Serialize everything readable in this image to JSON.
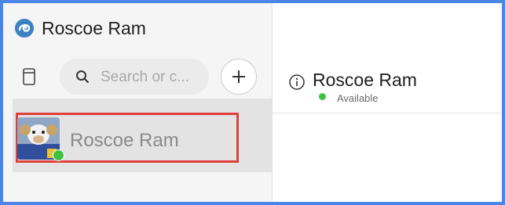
{
  "app": {
    "title": "Roscoe Ram"
  },
  "search": {
    "placeholder": "Search or c..."
  },
  "contacts": [
    {
      "name": "Roscoe Ram",
      "status": "online"
    }
  ],
  "chat": {
    "title": "Roscoe Ram",
    "status": "Available"
  },
  "colors": {
    "frame": "#4a86e8",
    "highlight": "#e0403c",
    "online": "#3fc23f"
  },
  "icons": [
    "app-logo-icon",
    "compose-icon",
    "search-icon",
    "plus-icon",
    "info-icon"
  ]
}
